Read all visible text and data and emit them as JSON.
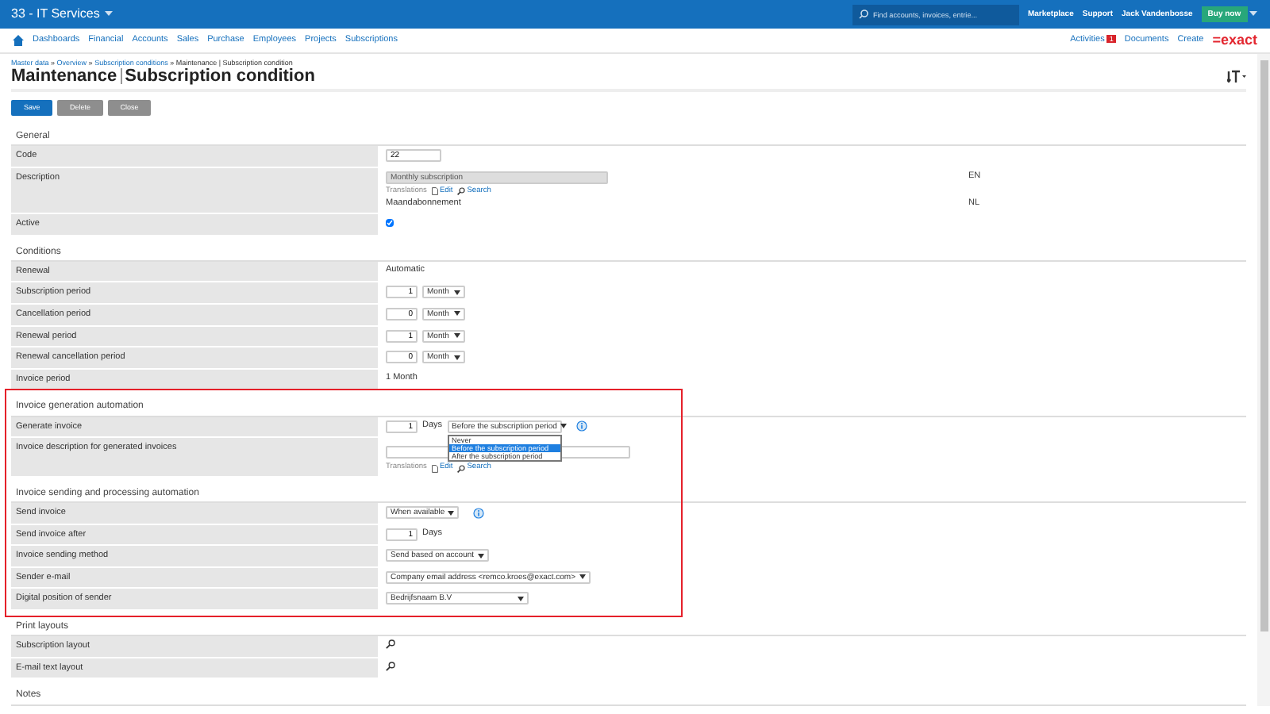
{
  "topbar": {
    "company": "33 - IT Services",
    "search": {
      "placeholder": "Find accounts, invoices, entrie..."
    },
    "links": [
      "Marketplace",
      "Support"
    ],
    "user": "Jack Vandenbosse",
    "buy": "Buy now"
  },
  "nav": {
    "items": [
      "Dashboards",
      "Financial",
      "Accounts",
      "Sales",
      "Purchase",
      "Employees",
      "Projects",
      "Subscriptions"
    ],
    "right": [
      {
        "label": "Activities",
        "badge": "1"
      },
      {
        "label": "Documents"
      },
      {
        "label": "Create"
      }
    ],
    "logo": "=exact"
  },
  "breadcrumb": [
    {
      "label": "Master data",
      "link": true
    },
    {
      "label": "Overview",
      "link": true
    },
    {
      "label": "Subscription conditions",
      "link": true
    },
    {
      "label": "Maintenance | Subscription condition",
      "link": false
    }
  ],
  "separator": "»",
  "title": {
    "main": "Maintenance",
    "sub": "Subscription condition"
  },
  "buttons": [
    {
      "label": "Save",
      "primary": true
    },
    {
      "label": "Delete",
      "primary": false
    },
    {
      "label": "Close",
      "primary": false
    }
  ],
  "sections": [
    {
      "title": "General",
      "highlighted": false,
      "rows": [
        {
          "kind": "input",
          "label": "Code",
          "value": "22"
        },
        {
          "kind": "translated",
          "label": "Description",
          "value": "Monthly subscription",
          "lang": "EN",
          "translations": [
            "Translations",
            "Edit",
            "Search"
          ],
          "alt": "Maandabonnement",
          "alt_lang": "NL"
        },
        {
          "kind": "checkbox",
          "label": "Active",
          "checked": true
        }
      ]
    },
    {
      "title": "Conditions",
      "highlighted": false,
      "rows": [
        {
          "kind": "text",
          "label": "Renewal",
          "value": "Automatic"
        },
        {
          "kind": "period",
          "label": "Subscription period",
          "number": "1",
          "unit": "Month"
        },
        {
          "kind": "period",
          "label": "Cancellation period",
          "number": "0",
          "unit": "Month"
        },
        {
          "kind": "period",
          "label": "Renewal period",
          "number": "1",
          "unit": "Month"
        },
        {
          "kind": "period",
          "label": "Renewal cancellation period",
          "number": "0",
          "unit": "Month"
        },
        {
          "kind": "text",
          "label": "Invoice period",
          "value": "1 Month"
        }
      ]
    },
    {
      "title": "Invoice generation automation",
      "highlighted": true,
      "rows": [
        {
          "kind": "days-select",
          "label": "Generate invoice",
          "number": "1",
          "unit": "Days",
          "value": "Before the subscription period",
          "info": true,
          "options": [
            {
              "label": "Never",
              "selected": false
            },
            {
              "label": "Before the subscription period",
              "selected": true
            },
            {
              "label": "After the subscription period",
              "selected": false
            }
          ]
        },
        {
          "kind": "wide-input",
          "label": "Invoice description for generated invoices",
          "translations": [
            "Translations",
            "Edit",
            "Search"
          ]
        }
      ]
    },
    {
      "title": "Invoice sending and processing automation",
      "highlighted": true,
      "rows": [
        {
          "kind": "select",
          "label": "Send invoice",
          "value": "When available",
          "info": true
        },
        {
          "kind": "days",
          "label": "Send invoice after",
          "number": "1",
          "unit": "Days"
        },
        {
          "kind": "select",
          "label": "Invoice sending method",
          "value": "Send based on account"
        },
        {
          "kind": "select",
          "label": "Sender e-mail",
          "value": "Company email address <remco.kroes@exact.com>"
        },
        {
          "kind": "wide-select",
          "label": "Digital position of sender",
          "value": "Bedrijfsnaam B.V"
        }
      ]
    },
    {
      "title": "Print layouts",
      "highlighted": false,
      "rows": [
        {
          "kind": "lookup",
          "label": "Subscription layout"
        },
        {
          "kind": "lookup",
          "label": "E-mail text layout"
        }
      ]
    },
    {
      "title": "Notes",
      "highlighted": false
    }
  ]
}
